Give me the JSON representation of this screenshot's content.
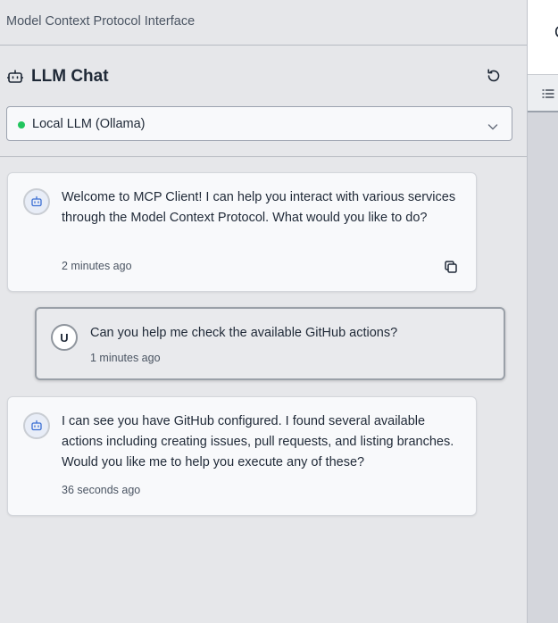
{
  "app": {
    "title": "Model Context Protocol Interface"
  },
  "chat": {
    "title": "LLM Chat",
    "icon": "bot-icon",
    "refresh_icon": "refresh-icon"
  },
  "model_select": {
    "selected": "Local LLM (Ollama)",
    "status_color": "#22c55e",
    "icon": "chevron-down-icon"
  },
  "messages": [
    {
      "role": "assistant",
      "text": "Welcome to MCP Client! I can help you interact with various services through the Model Context Protocol. What would you like to do?",
      "time": "2 minutes ago",
      "action_icon": "copy-icon"
    },
    {
      "role": "user",
      "avatar": "U",
      "text": "Can you help me check the available GitHub actions?",
      "time": "1 minutes ago"
    },
    {
      "role": "assistant",
      "text": "I can see you have GitHub configured. I found several available actions including creating issues, pull requests, and listing branches. Would you like me to help you execute any of these?",
      "time": "36 seconds ago"
    }
  ],
  "right_panel": {
    "top_glyph": "C",
    "tab_icon": "list-icon"
  }
}
